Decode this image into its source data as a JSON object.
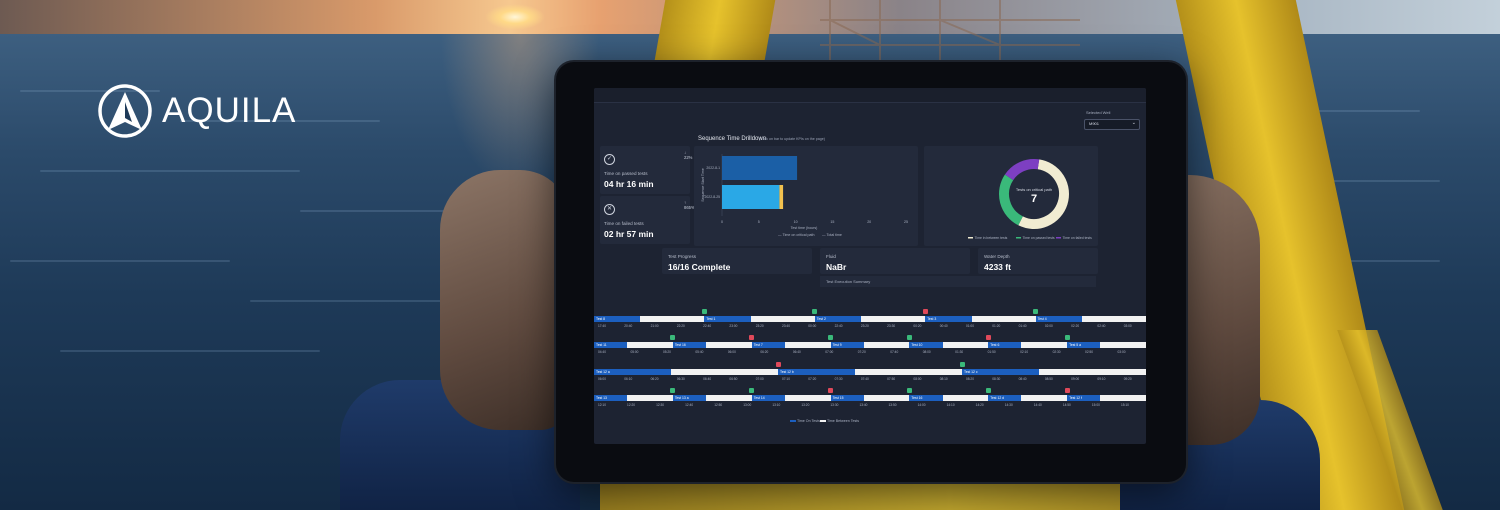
{
  "brand": {
    "name": "AQUILA"
  },
  "dashboard": {
    "well_selector": {
      "label": "Selected Well",
      "value": "M901"
    },
    "drilldown": {
      "title": "Sequence Time Drilldown",
      "subtitle": "(Click on bar to update KPIs on the page)"
    },
    "kpis": [
      {
        "label": "Time on passed tests",
        "value": "04 hr 16 min",
        "change": "22%",
        "icon": "check-circle-icon"
      },
      {
        "label": "Time on failed tests",
        "value": "02 hr 57 min",
        "change": "865%",
        "icon": "x-circle-icon"
      }
    ],
    "info": [
      {
        "label": "Test Progress",
        "value": "16/16 Complete"
      },
      {
        "label": "Fluid",
        "value": "NaBr"
      },
      {
        "label": "Water Depth",
        "value": "4233 ft"
      }
    ],
    "summary_label": "Test Execution Summary",
    "timeline_legend": [
      "Time On Tests",
      "Time Between Tests"
    ]
  },
  "chart_data": [
    {
      "type": "bar",
      "orientation": "horizontal",
      "xlabel": "Test time (hours)",
      "ylabel": "Sequence Start Time",
      "categories": [
        "2022-8-1",
        "2022-8-25"
      ],
      "series": [
        {
          "name": "Time on critical path",
          "values": [
            10.2,
            7.8
          ]
        },
        {
          "name": "Total time",
          "values": [
            0,
            0.5
          ]
        }
      ],
      "xticks": [
        0,
        5,
        10,
        15,
        20,
        25
      ],
      "xlim": [
        0,
        25
      ],
      "colors": [
        "#1b5fa6",
        "#2aa8e6",
        "#f2c14e"
      ]
    },
    {
      "type": "pie",
      "style": "donut",
      "center_label": "Tests on critical path",
      "center_value": "7",
      "slices": [
        {
          "name": "Time in between tests",
          "value": 55,
          "color": "#f1ecd2"
        },
        {
          "name": "Time on passed tests",
          "value": 27,
          "color": "#3ab97a"
        },
        {
          "name": "Time on failed tests",
          "value": 18,
          "color": "#7d3fc2"
        }
      ]
    }
  ],
  "timeline": [
    {
      "labels": [
        "Test 8",
        "Test 1",
        "Test 2",
        "Test 3",
        "Test 4"
      ],
      "times": [
        "17:40",
        "20:40",
        "21:00",
        "22:20",
        "22:40",
        "23:00",
        "23:20",
        "23:40",
        "00:00",
        "22:40",
        "23:20",
        "23:30",
        "00:20",
        "00:40",
        "01:00",
        "01:20",
        "01:40",
        "02:00",
        "02:20",
        "02:40",
        "03:00"
      ]
    },
    {
      "labels": [
        "Test 11",
        "Test 16",
        "Test 7",
        "Test 9",
        "Test 10",
        "Test 6",
        "Test 5 a"
      ],
      "times": [
        "04:40",
        "05:00",
        "05:20",
        "05:40",
        "06:00",
        "06:20",
        "06:40",
        "07:00",
        "07:20",
        "07:40",
        "08:00",
        "01:30",
        "01:50",
        "02:10",
        "02:30",
        "02:50",
        "03:00"
      ]
    },
    {
      "labels": [
        "Test 12 a",
        "Test 12 b",
        "Test 12 c"
      ],
      "times": [
        "06:00",
        "06:10",
        "06:20",
        "06:30",
        "06:40",
        "06:50",
        "07:00",
        "07:10",
        "07:20",
        "07:30",
        "07:40",
        "07:50",
        "08:00",
        "08:10",
        "08:20",
        "08:30",
        "08:40",
        "08:50",
        "09:00",
        "09:10",
        "09:20"
      ]
    },
    {
      "labels": [
        "Test 13",
        "Test 13 a",
        "Test 14",
        "Test 15",
        "Test 16",
        "Test 12 d",
        "Test 12 f"
      ],
      "times": [
        "12:10",
        "12:20",
        "12:30",
        "12:40",
        "12:50",
        "13:00",
        "13:10",
        "13:20",
        "13:30",
        "13:40",
        "13:50",
        "14:00",
        "14:10",
        "14:20",
        "14:30",
        "14:40",
        "14:50",
        "15:00",
        "15:10"
      ]
    }
  ]
}
